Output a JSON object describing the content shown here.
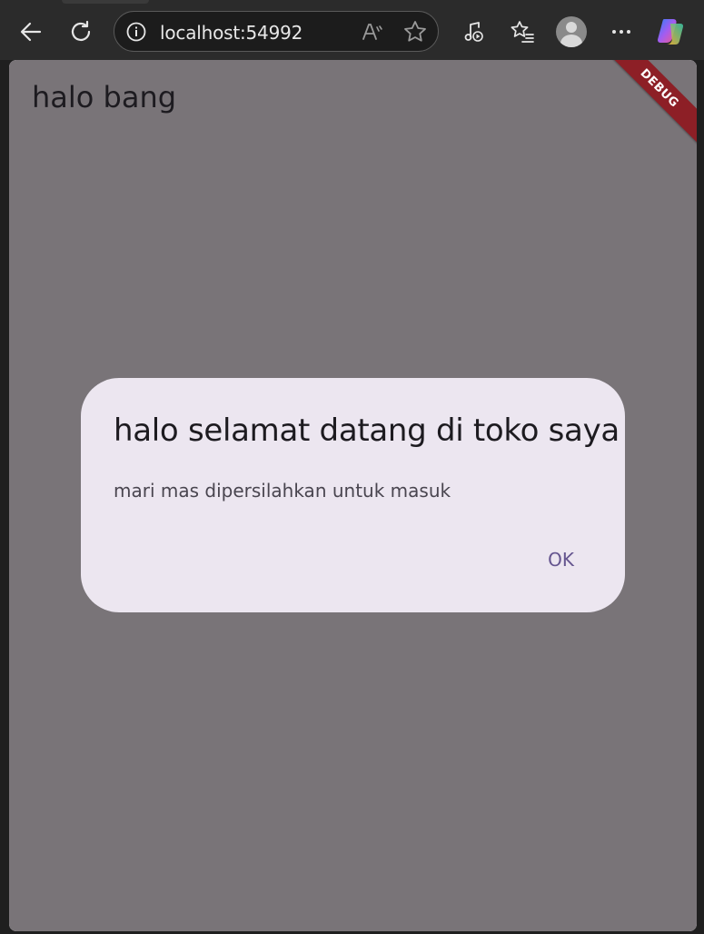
{
  "browser": {
    "url": "localhost:54992",
    "icons": {
      "back": "arrow-left-icon",
      "refresh": "refresh-icon",
      "site_info": "info-icon",
      "read_aloud": "read-aloud-icon",
      "favorite": "star-icon",
      "media": "media-control-icon",
      "favorites": "favorites-list-icon",
      "profile": "avatar-icon",
      "more": "more-dots-icon",
      "copilot": "copilot-icon"
    }
  },
  "app": {
    "title": "halo bang",
    "debug_banner": "DEBUG",
    "colors": {
      "scrim": "#797478",
      "dialog_background": "#ece6f0",
      "accent": "#65558f",
      "debug_banner": "#8d1f26"
    }
  },
  "dialog": {
    "title": "halo selamat datang di toko saya",
    "content": "mari mas dipersilahkan untuk masuk",
    "ok_label": "OK"
  }
}
